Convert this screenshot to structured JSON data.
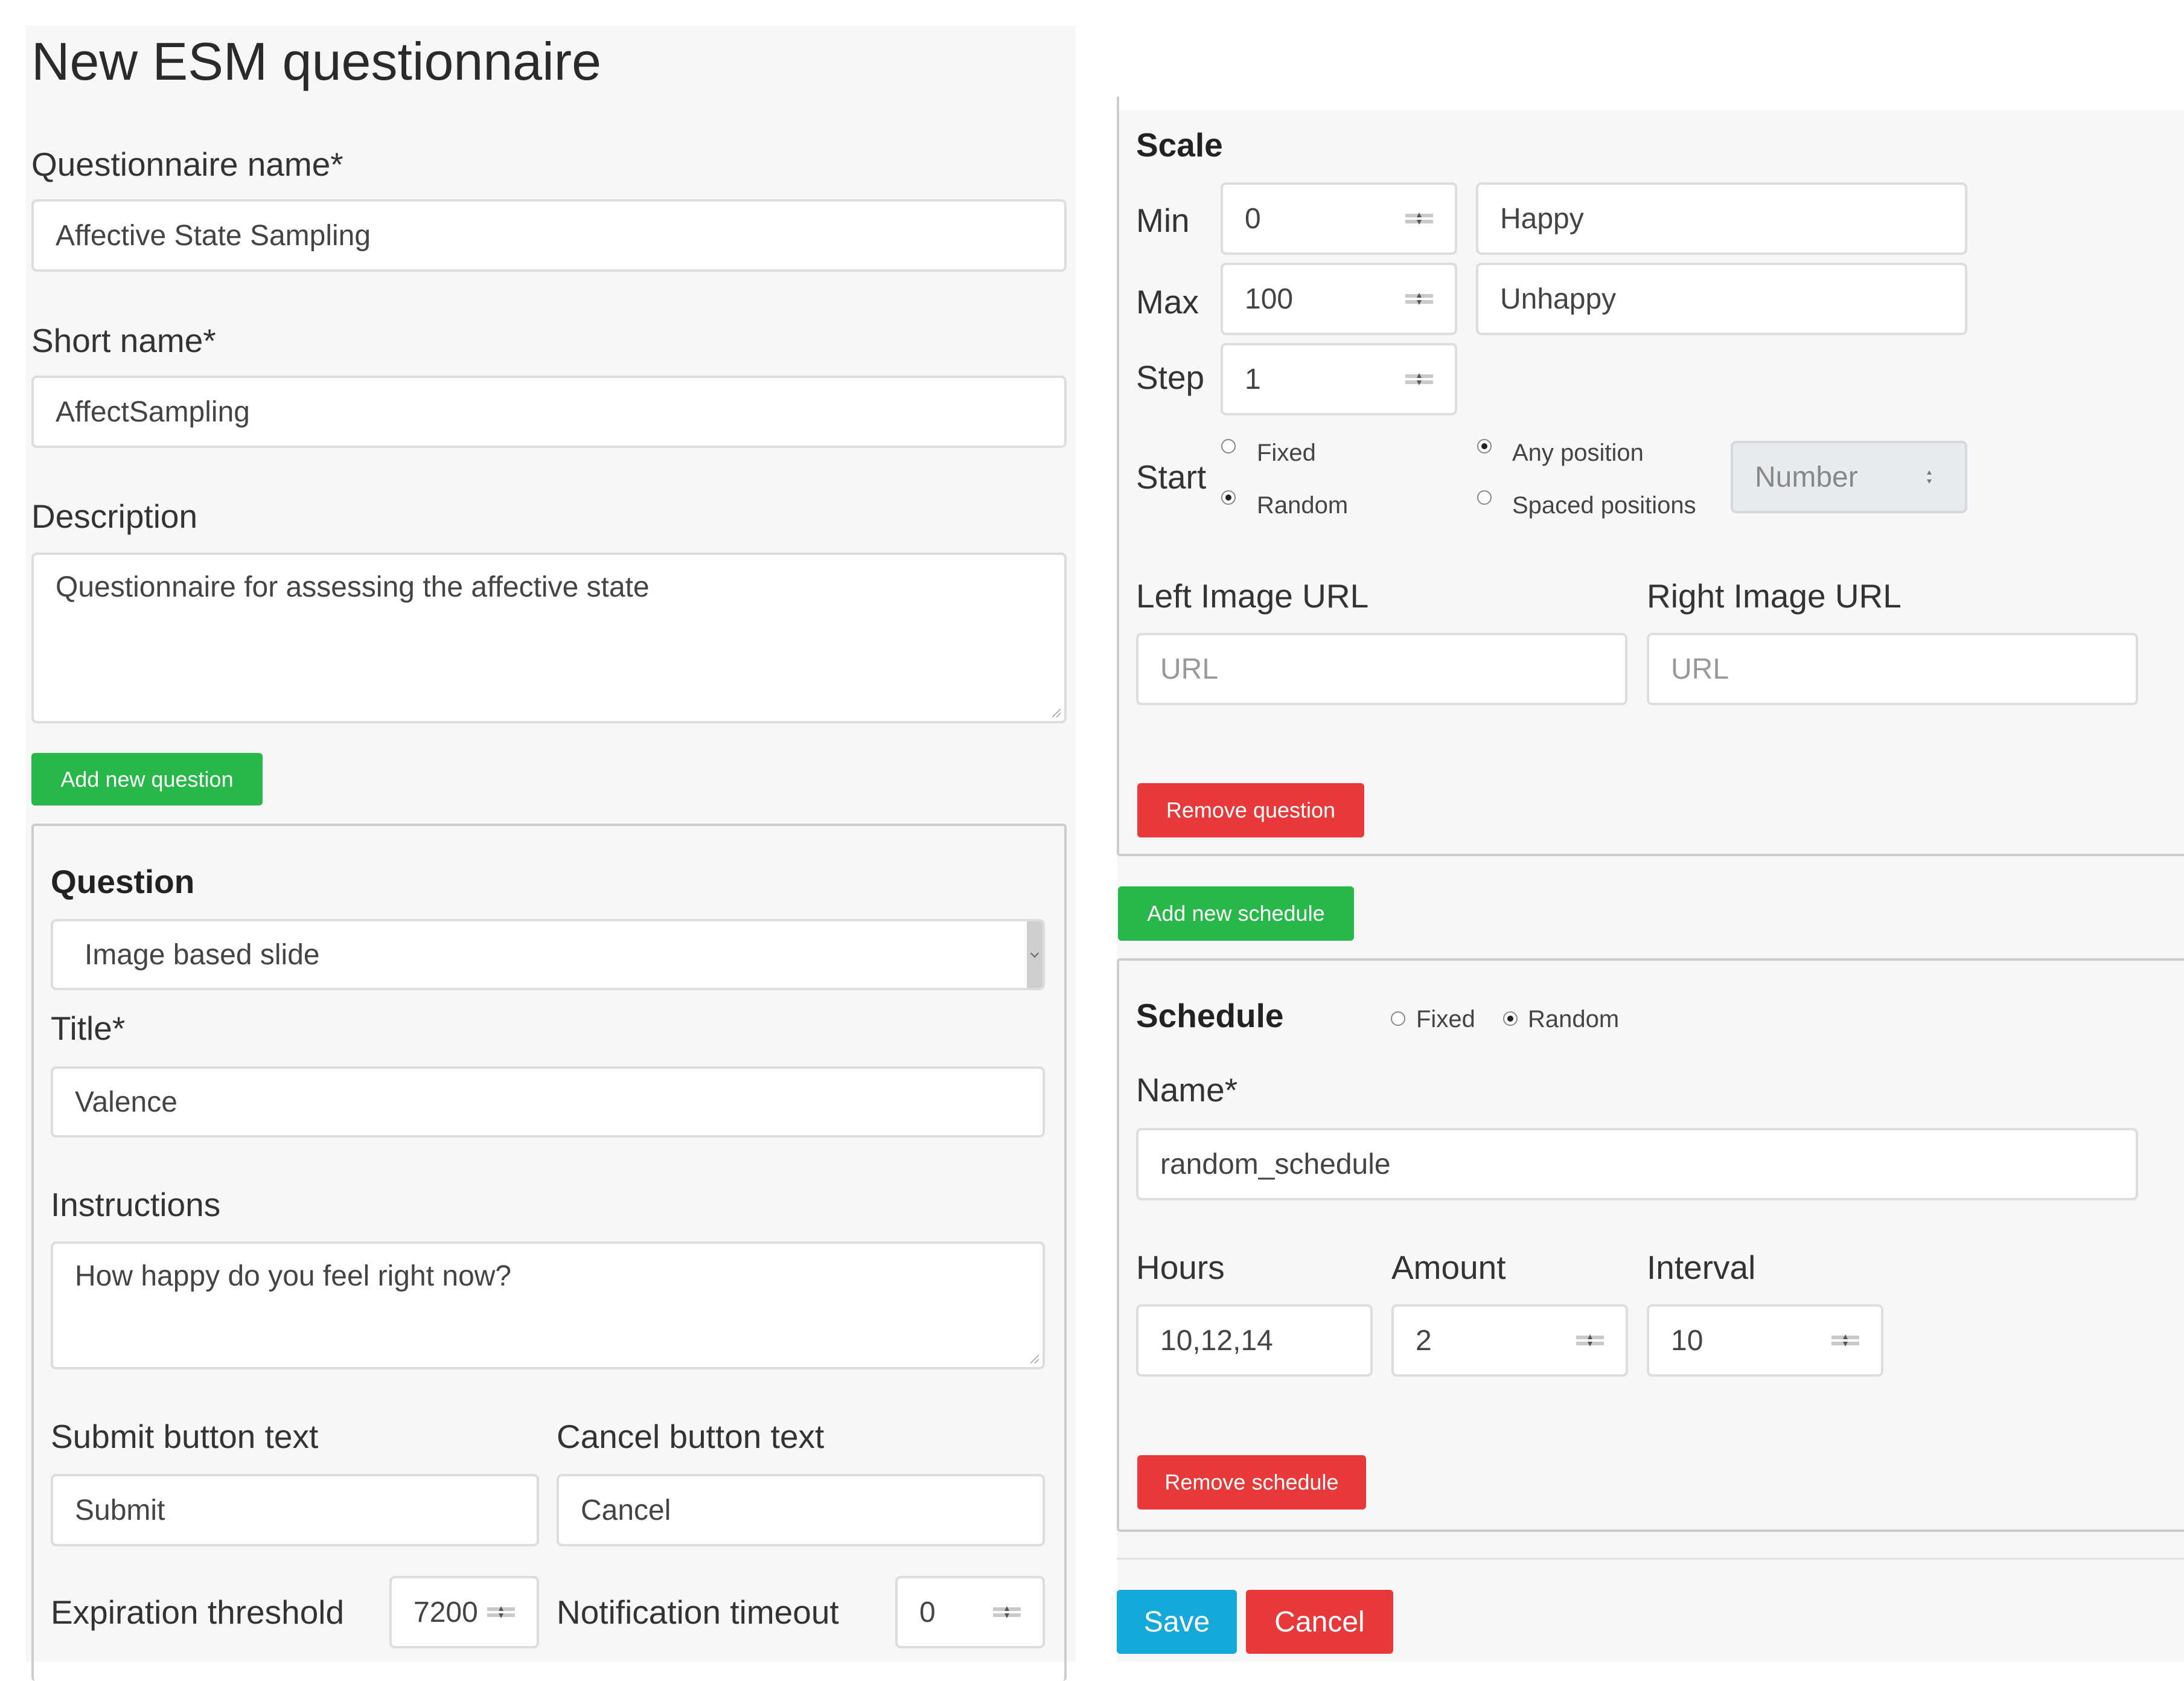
{
  "page": {
    "title": "New ESM questionnaire"
  },
  "questionnaire": {
    "name_label": "Questionnaire name*",
    "name_value": "Affective State Sampling",
    "short_label": "Short name*",
    "short_value": "AffectSampling",
    "description_label": "Description",
    "description_value": "Questionnaire for assessing the affective state",
    "add_question_label": "Add new question"
  },
  "question": {
    "heading": "Question",
    "type_value": "Image based slide",
    "title_label": "Title*",
    "title_value": "Valence",
    "instructions_label": "Instructions",
    "instructions_value": "How happy do you feel right now?",
    "submit_label": "Submit button text",
    "submit_value": "Submit",
    "cancel_label": "Cancel button text",
    "cancel_value": "Cancel",
    "expiration_label": "Expiration threshold",
    "expiration_value": "7200",
    "notification_label": "Notification timeout",
    "notification_value": "0"
  },
  "scale": {
    "heading": "Scale",
    "min_label": "Min",
    "min_value": "0",
    "min_text": "Happy",
    "max_label": "Max",
    "max_value": "100",
    "max_text": "Unhappy",
    "step_label": "Step",
    "step_value": "1",
    "start_label": "Start",
    "start_fixed": "Fixed",
    "start_random": "Random",
    "start_selected": "Random",
    "pos_any": "Any position",
    "pos_spaced": "Spaced positions",
    "pos_selected": "Any position",
    "number_placeholder": "Number",
    "left_url_label": "Left Image URL",
    "left_url_placeholder": "URL",
    "right_url_label": "Right Image URL",
    "right_url_placeholder": "URL",
    "remove_question_label": "Remove question"
  },
  "schedule": {
    "add_label": "Add new schedule",
    "heading": "Schedule",
    "type_fixed": "Fixed",
    "type_random": "Random",
    "type_selected": "Random",
    "name_label": "Name*",
    "name_value": "random_schedule",
    "hours_label": "Hours",
    "hours_value": "10,12,14",
    "amount_label": "Amount",
    "amount_value": "2",
    "interval_label": "Interval",
    "interval_value": "10",
    "remove_label": "Remove schedule"
  },
  "actions": {
    "save_label": "Save",
    "cancel_label": "Cancel"
  },
  "colors": {
    "green": "#28b84a",
    "red": "#e8393a",
    "blue": "#14a9d8"
  }
}
